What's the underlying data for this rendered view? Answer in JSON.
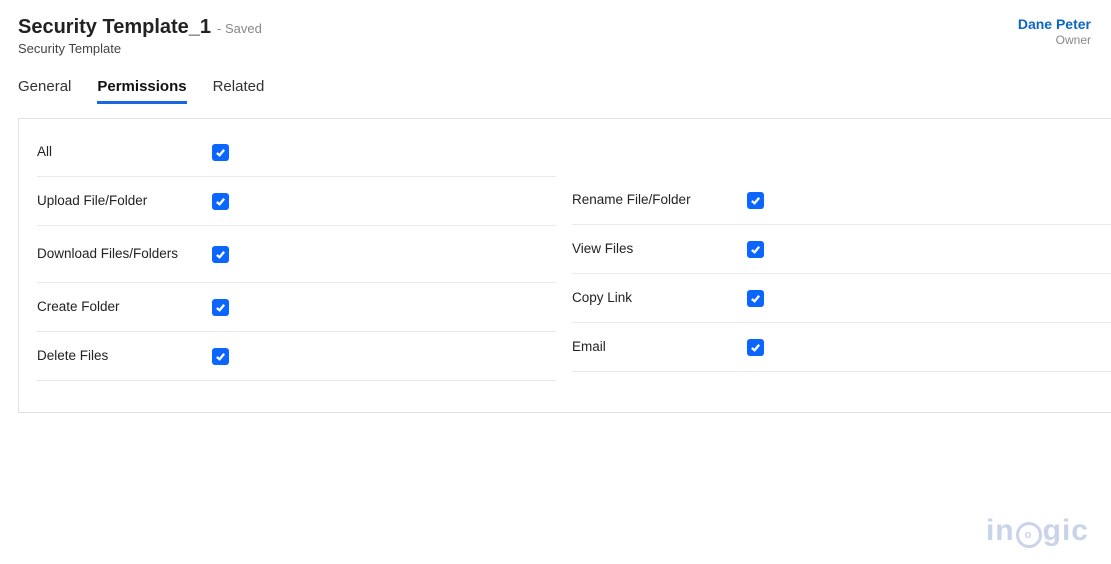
{
  "header": {
    "title": "Security Template_1",
    "saved_state": "- Saved",
    "subtitle": "Security Template",
    "owner_name": "Dane Peter",
    "owner_role": "Owner"
  },
  "tabs": {
    "general": "General",
    "permissions": "Permissions",
    "related": "Related",
    "active": "permissions"
  },
  "permissions": {
    "left": [
      {
        "key": "all",
        "label": "All",
        "checked": true
      },
      {
        "key": "upload",
        "label": "Upload File/Folder",
        "checked": true
      },
      {
        "key": "download",
        "label": "Download Files/Folders",
        "checked": true
      },
      {
        "key": "create",
        "label": "Create Folder",
        "checked": true
      },
      {
        "key": "delete",
        "label": "Delete Files",
        "checked": true
      }
    ],
    "right": [
      {
        "key": "rename",
        "label": "Rename File/Folder",
        "checked": true
      },
      {
        "key": "view",
        "label": "View Files",
        "checked": true
      },
      {
        "key": "copylink",
        "label": "Copy Link",
        "checked": true
      },
      {
        "key": "email",
        "label": "Email",
        "checked": true
      }
    ]
  },
  "watermark": {
    "part1": "in",
    "o_char": "o",
    "part2": "gic"
  }
}
